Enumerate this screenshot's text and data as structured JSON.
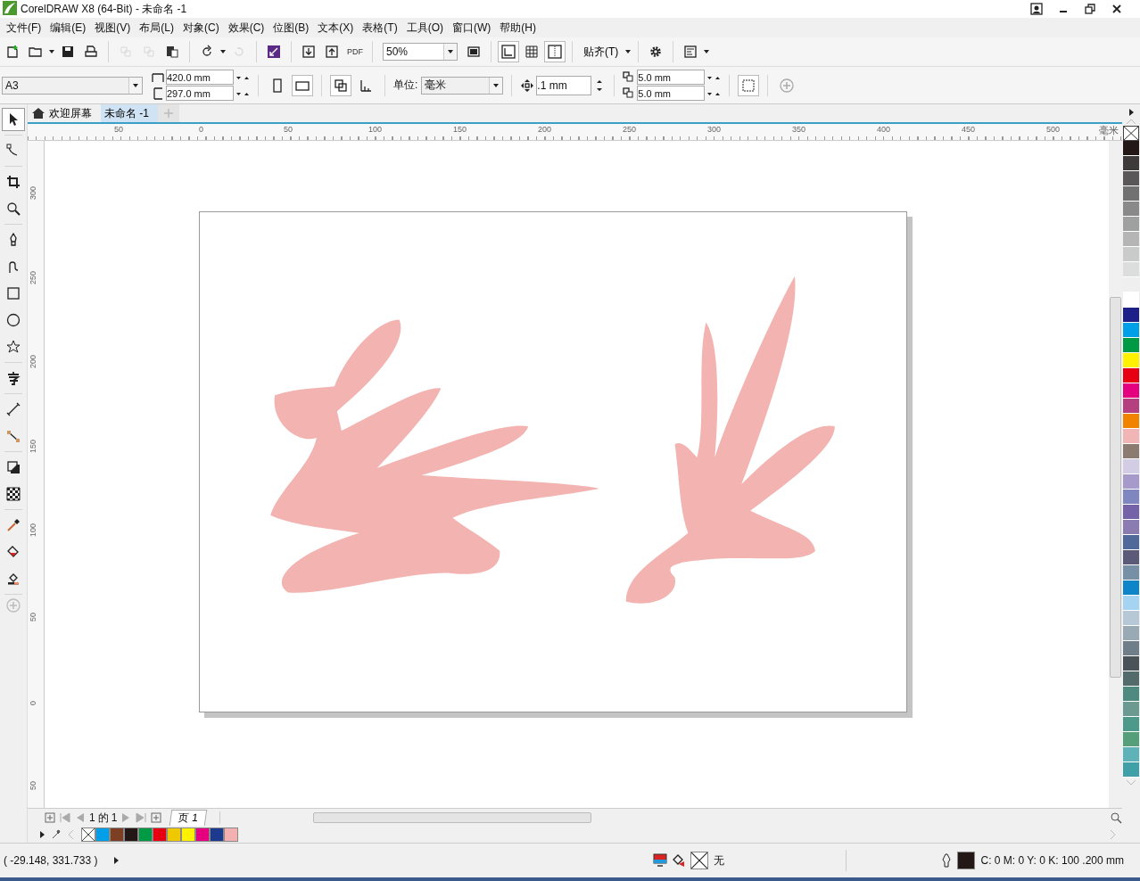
{
  "window": {
    "title": "CorelDRAW X8 (64-Bit) - 未命名 -1"
  },
  "menus": [
    "文件(F)",
    "编辑(E)",
    "视图(V)",
    "布局(L)",
    "对象(C)",
    "效果(C)",
    "位图(B)",
    "文本(X)",
    "表格(T)",
    "工具(O)",
    "窗口(W)",
    "帮助(H)"
  ],
  "toolbar": {
    "pdf_label": "PDF",
    "zoom": "50%",
    "snap": "贴齐(T)"
  },
  "property_bar": {
    "page_size": "A3",
    "width": "420.0 mm",
    "height": "297.0 mm",
    "unit_label": "单位:",
    "unit": "毫米",
    "nudge": ".1 mm",
    "dup_x": "5.0 mm",
    "dup_y": "5.0 mm"
  },
  "tools": [
    {
      "selected": true
    },
    {
      "selected": false
    },
    {
      "selected": false
    },
    {
      "selected": false
    },
    {
      "selected": false
    },
    {
      "selected": false
    },
    {
      "selected": false
    },
    {
      "selected": false
    },
    {
      "selected": false
    },
    {
      "selected": false
    },
    {
      "selected": false
    },
    {
      "selected": false
    },
    {
      "selected": false
    },
    {
      "selected": false
    },
    {
      "selected": false
    },
    {
      "selected": false
    },
    {
      "selected": false
    }
  ],
  "tabs": [
    {
      "label": "欢迎屏幕",
      "selected": false
    },
    {
      "label": "未命名 -1",
      "selected": true
    }
  ],
  "h_ruler": {
    "labels": [
      "50",
      "0",
      "50",
      "100",
      "150",
      "200",
      "250",
      "300",
      "350",
      "400",
      "450",
      "500"
    ],
    "unit": "毫米"
  },
  "v_ruler": {
    "labels": [
      "300",
      "250",
      "200",
      "150",
      "100",
      "50",
      "0",
      "50"
    ]
  },
  "page_nav": {
    "current": "1",
    "of": "的",
    "total": "1",
    "page_tab": "页 1"
  },
  "doc_palette": [
    {
      "kind": "none"
    },
    {
      "color": "#009fe8"
    },
    {
      "color": "#7d3f24"
    },
    {
      "color": "#231815"
    },
    {
      "color": "#009944"
    },
    {
      "color": "#e60012"
    },
    {
      "color": "#f0c800"
    },
    {
      "color": "#fff100"
    },
    {
      "color": "#e4007f"
    },
    {
      "color": "#1d3a8f"
    },
    {
      "color": "#f2b0b0"
    }
  ],
  "palette": [
    {
      "kind": "none"
    },
    {
      "color": "#231815"
    },
    {
      "color": "#3e3a39"
    },
    {
      "color": "#595757"
    },
    {
      "color": "#727171"
    },
    {
      "color": "#898989"
    },
    {
      "color": "#9fa0a0"
    },
    {
      "color": "#b5b5b6"
    },
    {
      "color": "#c9caca"
    },
    {
      "color": "#dcdddd"
    },
    {
      "color": "#efefef"
    },
    {
      "color": "#ffffff"
    },
    {
      "color": "#1d2088"
    },
    {
      "color": "#00a0e9"
    },
    {
      "color": "#009944"
    },
    {
      "color": "#fff100"
    },
    {
      "color": "#e60012"
    },
    {
      "color": "#e4007f"
    },
    {
      "color": "#b5407f"
    },
    {
      "color": "#f08300"
    },
    {
      "color": "#f2b5b5"
    },
    {
      "color": "#8c7b70"
    },
    {
      "color": "#d2cde5"
    },
    {
      "color": "#a59aca"
    },
    {
      "color": "#7f86c0"
    },
    {
      "color": "#7463a8"
    },
    {
      "color": "#8a7bb0"
    },
    {
      "color": "#4f6a9a"
    },
    {
      "color": "#5b5a78"
    },
    {
      "color": "#7790a5"
    },
    {
      "color": "#0f85c9"
    },
    {
      "color": "#a4d4f2"
    },
    {
      "color": "#b6c8d6"
    },
    {
      "color": "#99aab5"
    },
    {
      "color": "#6f7e88"
    },
    {
      "color": "#4a5358"
    },
    {
      "color": "#536b6b"
    },
    {
      "color": "#4e8a80"
    },
    {
      "color": "#6a9a90"
    },
    {
      "color": "#4d9a8a"
    },
    {
      "color": "#55a07a"
    },
    {
      "color": "#5fb2b8"
    },
    {
      "color": "#3fa0a8"
    }
  ],
  "status_bar": {
    "coordinates": "( -29.148, 331.733 )",
    "fill": "无",
    "outline": "C: 0 M: 0 Y: 0 K: 100  .200 mm"
  }
}
